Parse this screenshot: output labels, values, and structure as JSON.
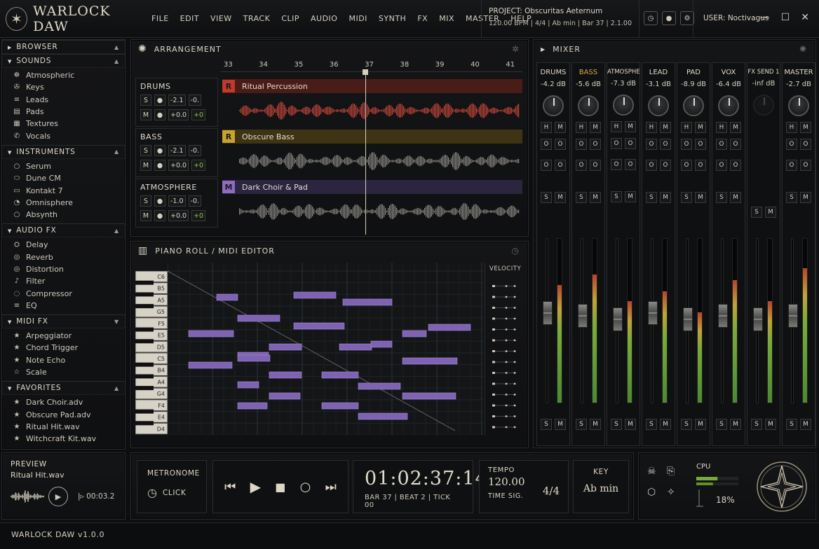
{
  "app": {
    "title": "WARLOCK DAW",
    "version": "WARLOCK DAW  v1.0.0"
  },
  "menu": [
    "FILE",
    "EDIT",
    "VIEW",
    "TRACK",
    "CLIP",
    "AUDIO",
    "MIDI",
    "SYNTH",
    "FX",
    "MIX",
    "MASTER",
    "HELP"
  ],
  "project": {
    "line1": "PROJECT: Obscuritas Aeternum",
    "line2": "120.00 BPM  |  4/4  |  Ab min  |  Bar 37  |  2.1.00"
  },
  "user": "USER: Noctivagus",
  "sidebar": {
    "browser": "BROWSER",
    "sounds": {
      "title": "SOUNDS",
      "items": [
        "Atmospheric",
        "Keys",
        "Leads",
        "Pads",
        "Textures",
        "Vocals"
      ]
    },
    "instruments": {
      "title": "INSTRUMENTS",
      "items": [
        "Serum",
        "Dune CM",
        "Kontakt 7",
        "Omnisphere",
        "Absynth"
      ]
    },
    "audio_fx": {
      "title": "AUDIO FX",
      "items": [
        "Delay",
        "Reverb",
        "Distortion",
        "Filter",
        "Compressor",
        "EQ"
      ]
    },
    "midi_fx": {
      "title": "MIDI FX",
      "items": [
        "Arpeggiator",
        "Chord Trigger",
        "Note Echo",
        "Scale"
      ]
    },
    "favorites": {
      "title": "FAVORITES",
      "items": [
        "Dark Choir.adv",
        "Obscure Pad.adv",
        "Ritual Hit.wav",
        "Witchcraft Kit.wav"
      ]
    }
  },
  "preview": {
    "title": "PREVIEW",
    "file": "Ritual Hit.wav",
    "time": "00:03.2"
  },
  "arrangement": {
    "title": "ARRANGEMENT",
    "bars": [
      "33",
      "34",
      "35",
      "36",
      "37",
      "38",
      "39",
      "40",
      "41"
    ],
    "tracks": [
      {
        "name": "DRUMS",
        "tag": "R",
        "clip": "Ritual Percussion",
        "vol": "-2.1",
        "pan": "-0.",
        "gain": "+0.0",
        "off": "+0",
        "color": "#c0392b",
        "bg": "#4a1c17",
        "wave": "#c9463a"
      },
      {
        "name": "BASS",
        "tag": "R",
        "clip": "Obscure Bass",
        "vol": "-2.1",
        "pan": "-0.",
        "gain": "+0.0",
        "off": "+0",
        "color": "#c9a233",
        "bg": "#3e3414",
        "wave": "#8c8a84"
      },
      {
        "name": "ATMOSPHERE",
        "tag": "M",
        "clip": "Dark Choir & Pad",
        "vol": "-1.0",
        "pan": "-0.",
        "gain": "+0.0",
        "off": "+0",
        "color": "#8f6bc4",
        "bg": "#2b2540",
        "wave": "#8c8a84"
      }
    ]
  },
  "pianoroll": {
    "title": "PIANO ROLL / MIDI EDITOR",
    "velocity": "VELOCITY",
    "keys": [
      "C6",
      "B5",
      "A5",
      "G5",
      "F5",
      "E5",
      "D5",
      "C5",
      "B4",
      "A4",
      "G4",
      "F4",
      "E4",
      "D4"
    ]
  },
  "mixer": {
    "title": "MIXER",
    "channels": [
      {
        "name": "DRUMS",
        "db": "-4.2 dB",
        "level": 0.72,
        "fader": 0.38,
        "highlight": false
      },
      {
        "name": "BASS",
        "db": "-5.6 dB",
        "level": 0.78,
        "fader": 0.4,
        "highlight": true
      },
      {
        "name": "ATMOSPHERE",
        "db": "-7.3 dB",
        "level": 0.62,
        "fader": 0.42,
        "highlight": false
      },
      {
        "name": "LEAD",
        "db": "-3.1 dB",
        "level": 0.68,
        "fader": 0.38,
        "highlight": false
      },
      {
        "name": "PAD",
        "db": "-8.9 dB",
        "level": 0.55,
        "fader": 0.42,
        "highlight": false
      },
      {
        "name": "VOX",
        "db": "-6.4 dB",
        "level": 0.75,
        "fader": 0.4,
        "highlight": false
      },
      {
        "name": "FX SEND 1",
        "db": "-inf dB",
        "level": 0.62,
        "fader": 0.42,
        "highlight": false
      },
      {
        "name": "MASTER",
        "db": "-2.7 dB",
        "level": 0.82,
        "fader": 0.4,
        "highlight": false
      }
    ]
  },
  "transport": {
    "metronome": "METRONOME",
    "click": "CLICK",
    "time": "01:02:37:14",
    "bar": "BAR 37",
    "beat": "BEAT 2",
    "tick": "TICK 00",
    "tempo_label": "TEMPO",
    "tempo": "120.00",
    "timesig_label": "TIME SIG.",
    "timesig": "4/4",
    "key_label": "KEY",
    "key": "Ab min"
  },
  "cpu": {
    "label": "CPU",
    "value": "18%",
    "fraction": 0.18
  }
}
